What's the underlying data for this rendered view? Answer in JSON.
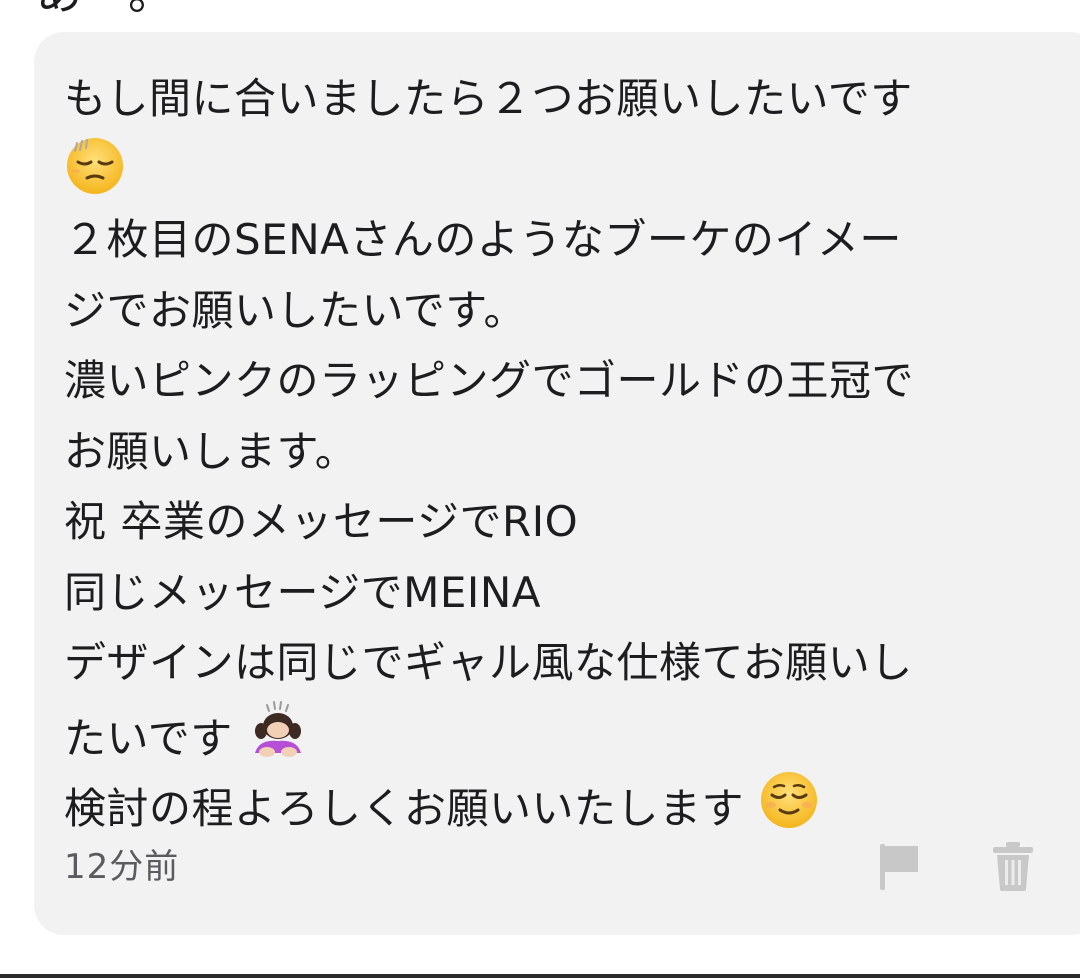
{
  "header": {
    "partial_text": "あ・。"
  },
  "comment": {
    "lines": [
      "もし間に合いましたら２つお願いしたいです",
      "",
      "２枚目のSENAさんのようなブーケのイメー",
      "ジでお願いしたいです。",
      "濃いピンクのラッピングでゴールドの王冠で",
      "お願いします。",
      "祝 卒業のメッセージでRIO",
      "同じメッセージでMEINA",
      "デザインは同じでギャル風な仕様てお願いし",
      "たいです",
      "検討の程よろしくお願いいたします"
    ],
    "emojis": {
      "line2": "sweat-smile-pensive-emoji",
      "line10": "person-bowing-emoji",
      "line11": "relieved-face-emoji"
    },
    "timestamp": "12分前"
  },
  "actions": {
    "flag_icon": "flag-icon",
    "trash_icon": "trash-icon"
  },
  "colors": {
    "bubble_background": "#f2f2f2",
    "text": "#1d1d1f",
    "timestamp_text": "#5b5b5f",
    "icon_gray": "#c8c8c8",
    "emoji_yellow": "#fbc02d"
  }
}
